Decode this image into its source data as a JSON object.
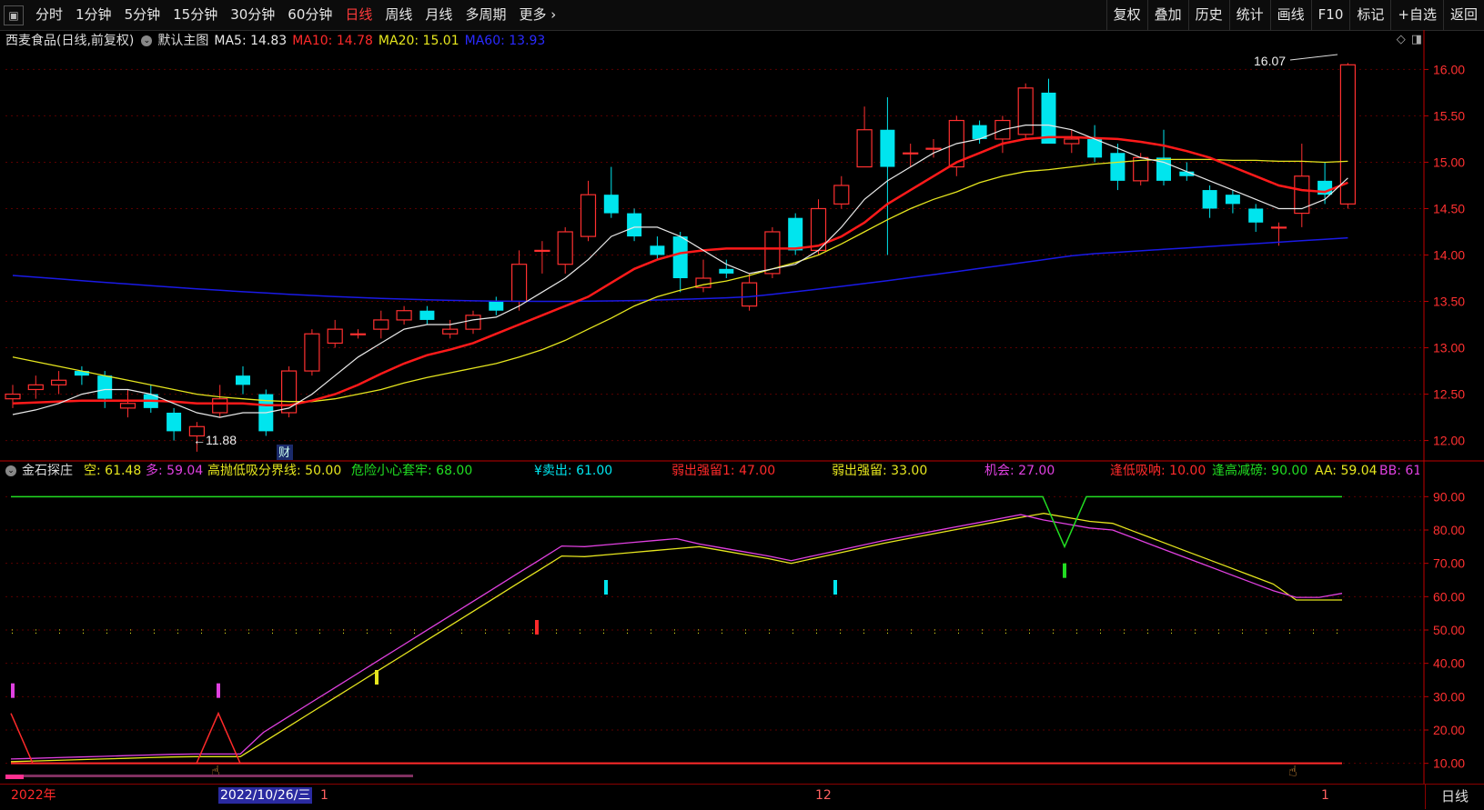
{
  "toolbar": {
    "periods": [
      "分时",
      "1分钟",
      "5分钟",
      "15分钟",
      "30分钟",
      "60分钟",
      "日线",
      "周线",
      "月线",
      "多周期",
      "更多 ›"
    ],
    "active_period": "日线",
    "right_buttons": [
      "复权",
      "叠加",
      "历史",
      "统计",
      "画线",
      "F10",
      "标记",
      "+自选",
      "返回"
    ]
  },
  "main_info": {
    "stock": "西麦食品(日线,前复权)",
    "template": "默认主图",
    "ma5": "MA5: 14.83",
    "ma10": "MA10: 14.78",
    "ma20": "MA20: 15.01",
    "ma60": "MA60: 13.93"
  },
  "indicator_info": {
    "name": "金石探庄",
    "kong": "空: 61.48",
    "duo": "多: 59.04",
    "gaopao": "高抛低吸分界线: 50.00",
    "weixian": "危险小心套牢: 68.00",
    "maichu": "¥卖出: 61.00",
    "ruochu1": "弱出强留1: 47.00",
    "ruochu": "弱出强留: 33.00",
    "jihui": "机会: 27.00",
    "fengdi": "逢低吸呐: 10.00",
    "fenggao": "逢高减磅: 90.00",
    "aa": "AA: 59.04",
    "bb": "BB: 61"
  },
  "price_labels": [
    "16.00",
    "15.50",
    "15.00",
    "14.50",
    "14.00",
    "13.50",
    "13.00",
    "12.50",
    "12.00"
  ],
  "indicator_labels": [
    "90.00",
    "80.00",
    "70.00",
    "60.00",
    "50.00",
    "40.00",
    "30.00",
    "20.00",
    "10.00"
  ],
  "annotations": {
    "high": "16.07",
    "low": "←11.88",
    "cai": "财"
  },
  "dates": {
    "year": "2022年",
    "cursor_date": "2022/10/26/三",
    "m1": "1",
    "m12": "12",
    "m1b": "1"
  },
  "bottom_tab": "日线",
  "colors": {
    "up": "#ff3030",
    "down": "#00e5ee",
    "ma5": "#e8e8e8",
    "ma10": "#ff1a1a",
    "ma20": "#e6e61e",
    "ma60": "#1a1ae6",
    "axis": "#c00000"
  },
  "chart_data": {
    "type": "candlestick",
    "ylim": [
      11.8,
      16.2
    ],
    "candles": [
      [
        12.45,
        12.5,
        12.6,
        12.35
      ],
      [
        12.55,
        12.6,
        12.7,
        12.45
      ],
      [
        12.6,
        12.65,
        12.75,
        12.5
      ],
      [
        12.75,
        12.7,
        12.8,
        12.6
      ],
      [
        12.7,
        12.45,
        12.75,
        12.35
      ],
      [
        12.35,
        12.4,
        12.55,
        12.25
      ],
      [
        12.5,
        12.35,
        12.6,
        12.3
      ],
      [
        12.3,
        12.1,
        12.35,
        12.0
      ],
      [
        12.05,
        12.15,
        12.2,
        11.88
      ],
      [
        12.3,
        12.45,
        12.6,
        12.25
      ],
      [
        12.7,
        12.6,
        12.8,
        12.5
      ],
      [
        12.5,
        12.1,
        12.55,
        12.05
      ],
      [
        12.3,
        12.75,
        12.8,
        12.25
      ],
      [
        12.75,
        13.15,
        13.2,
        12.7
      ],
      [
        13.05,
        13.2,
        13.3,
        13.0
      ],
      [
        13.15,
        13.15,
        13.2,
        13.1
      ],
      [
        13.2,
        13.3,
        13.4,
        13.1
      ],
      [
        13.3,
        13.4,
        13.45,
        13.25
      ],
      [
        13.4,
        13.3,
        13.45,
        13.25
      ],
      [
        13.15,
        13.2,
        13.3,
        13.1
      ],
      [
        13.2,
        13.35,
        13.4,
        13.15
      ],
      [
        13.5,
        13.4,
        13.55,
        13.35
      ],
      [
        13.5,
        13.9,
        14.05,
        13.4
      ],
      [
        14.05,
        14.05,
        14.15,
        13.8
      ],
      [
        13.9,
        14.25,
        14.3,
        13.8
      ],
      [
        14.2,
        14.65,
        14.8,
        14.15
      ],
      [
        14.65,
        14.45,
        14.95,
        14.4
      ],
      [
        14.45,
        14.2,
        14.5,
        14.15
      ],
      [
        14.1,
        14.0,
        14.2,
        13.95
      ],
      [
        14.2,
        13.75,
        14.25,
        13.6
      ],
      [
        13.65,
        13.75,
        13.95,
        13.6
      ],
      [
        13.85,
        13.8,
        13.95,
        13.75
      ],
      [
        13.45,
        13.7,
        13.8,
        13.4
      ],
      [
        13.8,
        14.25,
        14.3,
        13.75
      ],
      [
        14.4,
        14.05,
        14.45,
        14.0
      ],
      [
        14.05,
        14.5,
        14.6,
        14.0
      ],
      [
        14.55,
        14.75,
        14.85,
        14.5
      ],
      [
        14.95,
        15.35,
        15.6,
        14.95
      ],
      [
        15.35,
        14.95,
        15.7,
        14.0
      ],
      [
        15.1,
        15.1,
        15.2,
        14.95
      ],
      [
        15.15,
        15.15,
        15.25,
        15.05
      ],
      [
        14.95,
        15.45,
        15.5,
        14.85
      ],
      [
        15.4,
        15.25,
        15.45,
        15.2
      ],
      [
        15.25,
        15.45,
        15.5,
        15.1
      ],
      [
        15.3,
        15.8,
        15.85,
        15.25
      ],
      [
        15.75,
        15.2,
        15.9,
        15.2
      ],
      [
        15.2,
        15.25,
        15.35,
        15.1
      ],
      [
        15.25,
        15.05,
        15.4,
        15.0
      ],
      [
        15.1,
        14.8,
        15.2,
        14.7
      ],
      [
        14.8,
        15.05,
        15.1,
        14.75
      ],
      [
        15.05,
        14.8,
        15.35,
        14.75
      ],
      [
        14.9,
        14.85,
        15.0,
        14.8
      ],
      [
        14.7,
        14.5,
        14.75,
        14.4
      ],
      [
        14.65,
        14.55,
        14.7,
        14.45
      ],
      [
        14.5,
        14.35,
        14.55,
        14.25
      ],
      [
        14.3,
        14.3,
        14.35,
        14.1
      ],
      [
        14.45,
        14.85,
        15.2,
        14.3
      ],
      [
        14.8,
        14.65,
        15.0,
        14.55
      ],
      [
        14.55,
        16.05,
        16.07,
        14.5
      ]
    ],
    "ma5": [
      12.28,
      12.33,
      12.4,
      12.5,
      12.55,
      12.55,
      12.5,
      12.4,
      12.3,
      12.25,
      12.3,
      12.3,
      12.35,
      12.5,
      12.7,
      12.9,
      13.05,
      13.2,
      13.25,
      13.25,
      13.3,
      13.33,
      13.45,
      13.6,
      13.75,
      13.95,
      14.2,
      14.3,
      14.3,
      14.2,
      14.05,
      13.9,
      13.8,
      13.85,
      13.9,
      14.05,
      14.3,
      14.6,
      14.8,
      14.95,
      15.1,
      15.2,
      15.25,
      15.35,
      15.4,
      15.4,
      15.35,
      15.25,
      15.15,
      15.05,
      15.0,
      14.9,
      14.8,
      14.7,
      14.6,
      14.5,
      14.5,
      14.6,
      14.83
    ],
    "ma10": [
      12.4,
      12.41,
      12.42,
      12.43,
      12.43,
      12.43,
      12.43,
      12.42,
      12.4,
      12.4,
      12.4,
      12.38,
      12.38,
      12.43,
      12.5,
      12.6,
      12.72,
      12.83,
      12.92,
      12.98,
      13.05,
      13.15,
      13.25,
      13.35,
      13.45,
      13.55,
      13.7,
      13.85,
      13.95,
      14.02,
      14.05,
      14.07,
      14.07,
      14.07,
      14.07,
      14.1,
      14.2,
      14.35,
      14.55,
      14.7,
      14.85,
      15.0,
      15.1,
      15.2,
      15.25,
      15.27,
      15.27,
      15.26,
      15.25,
      15.22,
      15.18,
      15.12,
      15.05,
      14.95,
      14.85,
      14.75,
      14.7,
      14.68,
      14.78
    ],
    "ma20": [
      12.9,
      12.85,
      12.8,
      12.75,
      12.7,
      12.65,
      12.6,
      12.55,
      12.5,
      12.47,
      12.45,
      12.43,
      12.42,
      12.42,
      12.45,
      12.5,
      12.55,
      12.62,
      12.68,
      12.73,
      12.78,
      12.83,
      12.9,
      12.98,
      13.08,
      13.2,
      13.32,
      13.45,
      13.55,
      13.62,
      13.68,
      13.72,
      13.78,
      13.85,
      13.92,
      14.0,
      14.12,
      14.25,
      14.38,
      14.5,
      14.6,
      14.68,
      14.78,
      14.85,
      14.9,
      14.92,
      14.95,
      14.98,
      15.0,
      15.02,
      15.03,
      15.03,
      15.03,
      15.02,
      15.02,
      15.01,
      15.01,
      15.0,
      15.01
    ]
  }
}
